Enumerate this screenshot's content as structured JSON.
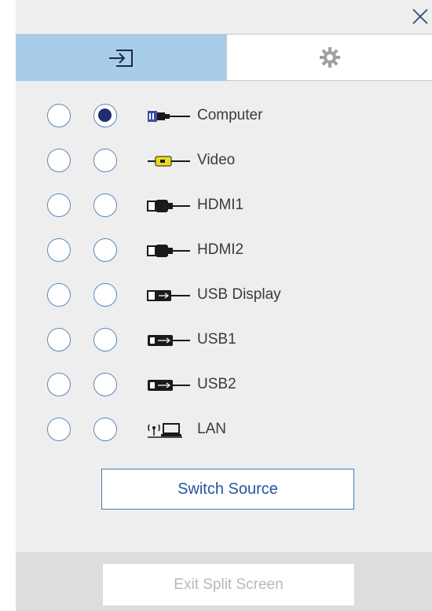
{
  "window": {
    "close_icon": "close-icon"
  },
  "tabs": [
    {
      "icon": "input-source-icon",
      "active": true
    },
    {
      "icon": "gear-icon",
      "active": false
    }
  ],
  "sources": [
    {
      "label": "Computer",
      "icon": "vga-cable-icon",
      "left_selected": false,
      "right_selected": true
    },
    {
      "label": "Video",
      "icon": "composite-cable-icon",
      "left_selected": false,
      "right_selected": false
    },
    {
      "label": "HDMI1",
      "icon": "hdmi-cable-icon",
      "left_selected": false,
      "right_selected": false
    },
    {
      "label": "HDMI2",
      "icon": "hdmi-cable-icon",
      "left_selected": false,
      "right_selected": false
    },
    {
      "label": "USB Display",
      "icon": "usb-cable-icon",
      "left_selected": false,
      "right_selected": false
    },
    {
      "label": "USB1",
      "icon": "usb-a-cable-icon",
      "left_selected": false,
      "right_selected": false
    },
    {
      "label": "USB2",
      "icon": "usb-a-cable-icon",
      "left_selected": false,
      "right_selected": false
    },
    {
      "label": "LAN",
      "icon": "wireless-computer-icon",
      "left_selected": false,
      "right_selected": false
    }
  ],
  "buttons": {
    "switch_source": "Switch Source",
    "exit_split_screen": "Exit Split Screen"
  },
  "colors": {
    "active_tab": "#a8cdea",
    "radio_border": "#5b88b8",
    "radio_selected": "#1e2e6e",
    "primary_button_text": "#2456a0",
    "disabled_text": "#b8b8b8"
  }
}
